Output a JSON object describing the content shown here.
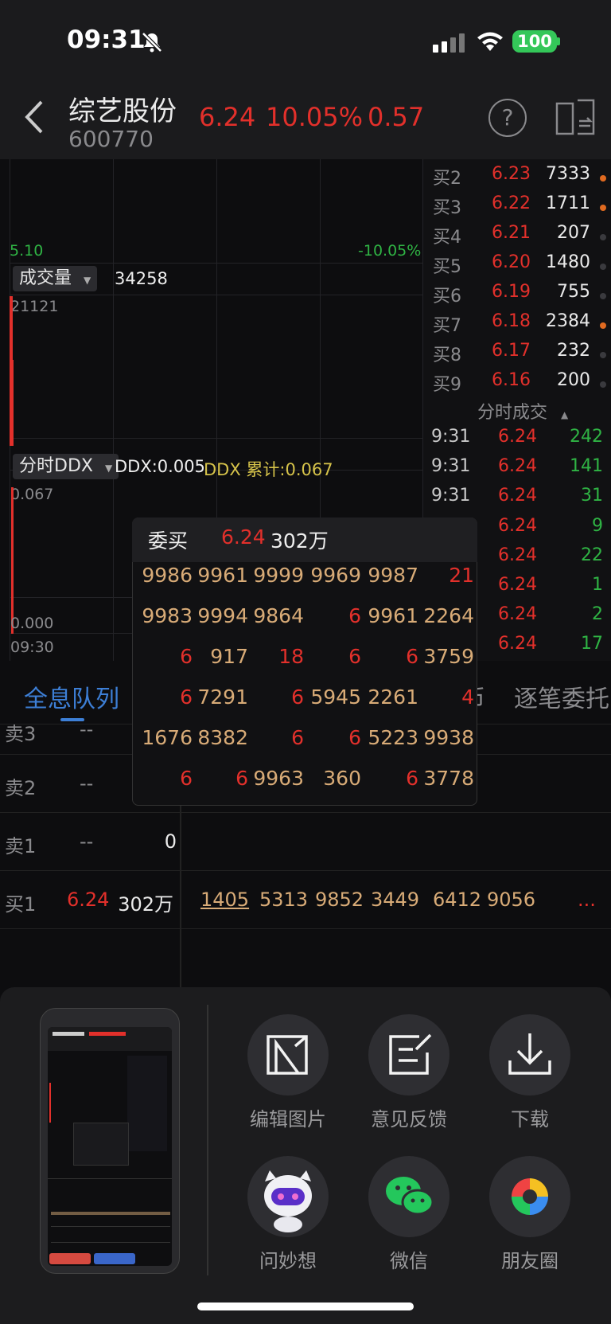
{
  "status": {
    "time": "09:31",
    "battery": "100"
  },
  "header": {
    "name": "综艺股份",
    "code": "600770",
    "price": "6.24",
    "pct": "10.05%",
    "chg": "0.57",
    "help": "?"
  },
  "chart": {
    "low_price": "5.10",
    "low_pct": "-10.05%",
    "volume_btn": "成交量",
    "volume_value": "34258",
    "volume_max": "21121",
    "ddx_btn": "分时DDX",
    "ddx_value": "DDX:0.005",
    "ddx_cum": "DDX 累计:0.067",
    "ddx_top": "0.067",
    "ddx_bottom": "0.000",
    "time_start": "09:30"
  },
  "order_book": {
    "rows": [
      {
        "label": "买2",
        "price": "6.23",
        "vol": "7333",
        "dot": "#e06a20"
      },
      {
        "label": "买3",
        "price": "6.22",
        "vol": "1711",
        "dot": "#e06a20"
      },
      {
        "label": "买4",
        "price": "6.21",
        "vol": "207",
        "dot": "#3a3a3e"
      },
      {
        "label": "买5",
        "price": "6.20",
        "vol": "1480",
        "dot": "#3a3a3e"
      },
      {
        "label": "买6",
        "price": "6.19",
        "vol": "755",
        "dot": "#3a3a3e"
      },
      {
        "label": "买7",
        "price": "6.18",
        "vol": "2384",
        "dot": "#e06a20"
      },
      {
        "label": "买8",
        "price": "6.17",
        "vol": "232",
        "dot": "#3a3a3e"
      },
      {
        "label": "买9",
        "price": "6.16",
        "vol": "200",
        "dot": "#3a3a3e"
      }
    ]
  },
  "ticks": {
    "title": "分时成交",
    "rows": [
      {
        "time": "9:31",
        "price": "6.24",
        "vol": "242"
      },
      {
        "time": "9:31",
        "price": "6.24",
        "vol": "141"
      },
      {
        "time": "9:31",
        "price": "6.24",
        "vol": "31"
      },
      {
        "time": "",
        "price": "6.24",
        "vol": "9"
      },
      {
        "time": "",
        "price": "6.24",
        "vol": "22"
      },
      {
        "time": "",
        "price": "6.24",
        "vol": "1"
      },
      {
        "time": "",
        "price": "6.24",
        "vol": "2"
      },
      {
        "time": "",
        "price": "6.24",
        "vol": "17"
      }
    ]
  },
  "tabs": {
    "active": "全息队列",
    "mid": "币",
    "right": "逐笔委托"
  },
  "queue": {
    "rows": [
      {
        "label": "卖3",
        "price": "--",
        "size": ""
      },
      {
        "label": "卖2",
        "price": "--",
        "size": "0"
      },
      {
        "label": "卖1",
        "price": "--",
        "size": "0"
      },
      {
        "label": "买1",
        "price": "6.24",
        "size": "302万"
      }
    ],
    "buy1_orders": [
      "1405",
      "5313",
      "9852",
      "3449",
      "6412",
      "9056"
    ],
    "more": "..."
  },
  "popup": {
    "title": "委买",
    "price": "6.24",
    "size": "302万",
    "grid": [
      [
        "9986",
        "9961",
        "9999",
        "9969",
        "9987",
        "21"
      ],
      [
        "9983",
        "9994",
        "9864",
        "",
        "6",
        "9961",
        "2264"
      ],
      [
        "6",
        "917",
        "18",
        "6",
        "6",
        "3759"
      ],
      [
        "6",
        "7291",
        "6",
        "5945",
        "2261",
        "4"
      ],
      [
        "1676",
        "8382",
        "6",
        "6",
        "5223",
        "9938"
      ],
      [
        "6",
        "6",
        "9963",
        "360",
        "6",
        "3778"
      ]
    ]
  },
  "share": {
    "items": [
      {
        "label": "编辑图片",
        "icon": "edit-image-icon"
      },
      {
        "label": "意见反馈",
        "icon": "feedback-icon"
      },
      {
        "label": "下载",
        "icon": "download-icon"
      },
      {
        "label": "问妙想",
        "icon": "robot-assistant-icon"
      },
      {
        "label": "微信",
        "icon": "wechat-icon"
      },
      {
        "label": "朋友圈",
        "icon": "moments-icon"
      }
    ]
  }
}
